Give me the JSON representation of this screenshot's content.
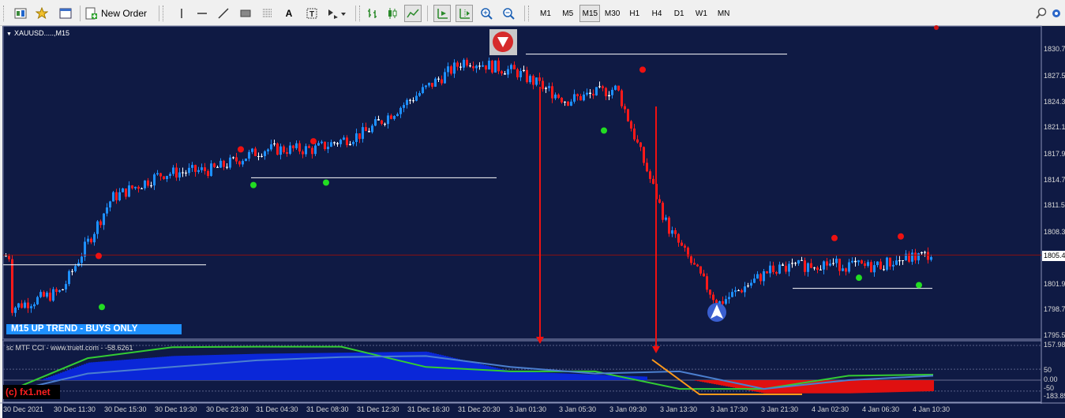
{
  "toolbar": {
    "new_order_label": "New Order",
    "timeframes": [
      "M1",
      "M5",
      "M15",
      "M30",
      "H1",
      "H4",
      "D1",
      "W1",
      "MN"
    ],
    "active_timeframe": "M15",
    "icons": [
      "profiles-icon",
      "favorites-icon",
      "window-icon",
      "new-order-icon",
      "cursor-icon",
      "vertical-line-icon",
      "horizontal-line-icon",
      "trend-line-icon",
      "rectangle-icon",
      "fibonacci-icon",
      "text-icon",
      "label-icon",
      "arrows-icon",
      "bar-chart-icon",
      "candle-chart-icon",
      "line-chart-icon",
      "autoscroll-icon",
      "chart-shift-icon",
      "zoom-in-icon",
      "zoom-out-icon",
      "search-icon",
      "settings-icon"
    ]
  },
  "chart": {
    "title": "XAUUSD.....,M15",
    "trend_label": "M15 UP TREND - BUYS ONLY",
    "watermark": "(c) fx1.net",
    "current_price": "1805.4",
    "colors": {
      "background": "#0f1a44",
      "bull": "#1e90ff",
      "neutral": "#ffffff",
      "bear": "#ff1a1a",
      "support_dot": "#22dd22",
      "resistance_dot": "#ee1111",
      "cci_fast": "#33cc33",
      "cci_slow": "#4b7fcf",
      "cci_hist_up": "#0a27d8",
      "cci_hist_down": "#e01010"
    }
  },
  "indicator": {
    "title": "sc MTF CCI - www.truetl.com - -58.6261",
    "levels": [
      "157.98",
      "50",
      "0.00",
      "-50",
      "-183.85"
    ]
  },
  "price_axis": [
    "1830.75",
    "1827.55",
    "1824.35",
    "1821.15",
    "1817.95",
    "1814.75",
    "1811.55",
    "1808.35",
    "1805.40",
    "1801.95",
    "1798.75",
    "1795.55"
  ],
  "time_axis": [
    "30 Dec 2021",
    "30 Dec 11:30",
    "30 Dec 15:30",
    "30 Dec 19:30",
    "30 Dec 23:30",
    "31 Dec 04:30",
    "31 Dec 08:30",
    "31 Dec 12:30",
    "31 Dec 16:30",
    "31 Dec 20:30",
    "3 Jan 01:30",
    "3 Jan 05:30",
    "3 Jan 09:30",
    "3 Jan 13:30",
    "3 Jan 17:30",
    "3 Jan 21:30",
    "4 Jan 02:30",
    "4 Jan 06:30",
    "4 Jan 10:30"
  ],
  "chart_data": {
    "type": "candlestick",
    "symbol": "XAUUSD",
    "timeframe": "M15",
    "ylim": [
      1795.55,
      1831.5
    ],
    "path": [
      [
        "30 Dec 2021",
        1799.0
      ],
      [
        "30 Dec 11:30",
        1801.0
      ],
      [
        "30 Dec 15:30",
        1812.5
      ],
      [
        "30 Dec 19:30",
        1815.5
      ],
      [
        "30 Dec 23:30",
        1816.0
      ],
      [
        "31 Dec 04:30",
        1818.5
      ],
      [
        "31 Dec 08:30",
        1818.5
      ],
      [
        "31 Dec 12:30",
        1820.5
      ],
      [
        "31 Dec 16:30",
        1825.0
      ],
      [
        "31 Dec 20:30",
        1829.5
      ],
      [
        "3 Jan 01:30",
        1828.0
      ],
      [
        "3 Jan 05:30",
        1824.5
      ],
      [
        "3 Jan 09:30",
        1826.0
      ],
      [
        "3 Jan 13:30",
        1809.0
      ],
      [
        "3 Jan 17:30",
        1799.5
      ],
      [
        "3 Jan 21:30",
        1803.5
      ],
      [
        "4 Jan 02:30",
        1804.5
      ],
      [
        "4 Jan 06:30",
        1804.0
      ],
      [
        "4 Jan 10:30",
        1805.4
      ]
    ],
    "horizontal_levels": [
      1804.3,
      1815.0,
      1830.2,
      1801.4,
      1805.5
    ],
    "resistance_dots": [
      1805.2,
      1818.3,
      1819.3,
      1828.1,
      1807.4,
      1807.6
    ],
    "support_dots": [
      1799.4,
      1814.4,
      1814.7,
      1821.1,
      1803.0,
      1802.1
    ],
    "cci": {
      "title": "sc MTF CCI",
      "fast": [
        -60,
        100,
        150,
        152,
        152,
        60,
        40,
        40,
        -40,
        -40,
        20,
        25
      ],
      "slow": [
        -60,
        30,
        60,
        90,
        105,
        110,
        60,
        30,
        40,
        -40,
        0,
        20
      ],
      "histogram": [
        -60,
        80,
        110,
        120,
        125,
        130,
        40,
        25,
        10,
        -60,
        -60,
        -50
      ]
    }
  }
}
